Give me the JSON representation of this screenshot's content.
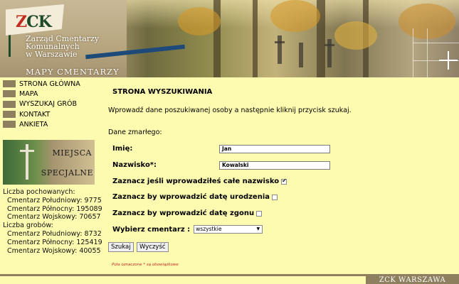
{
  "header": {
    "logo_text_a": "Z",
    "logo_text_b": "CK",
    "org_line1": "Zarząd Cmentarzy",
    "org_line2": "Komunalnych",
    "org_line3": "w Warszawie",
    "subtitle": "MAPY CMENTARZY"
  },
  "nav": {
    "items": [
      "STRONA GŁÓWNA",
      "MAPA",
      "WYSZUKAJ GRÓB",
      "KONTAKT",
      "ANKIETA"
    ]
  },
  "special": {
    "line1": "MIEJSCA",
    "line2": "SPECJALNE"
  },
  "stats": {
    "buried_label": "Liczba pochowanych:",
    "buried": [
      "Cmentarz Południowy: 9775",
      "Cmentarz Północny: 195089",
      "Cmentarz Wojskowy: 70657"
    ],
    "graves_label": "Liczba grobów:",
    "graves": [
      "Cmentarz Południowy: 8732",
      "Cmentarz Północny: 125419",
      "Cmentarz Wojskowy: 40055"
    ]
  },
  "main": {
    "title": "STRONA WYSZUKIWANIA",
    "intro": "Wprowadź dane poszukiwanej osoby a następnie kliknij przycisk szukaj.",
    "section": "Dane zmarłego:",
    "first_name_label": "Imię:",
    "first_name_value": "Jan",
    "last_name_label": "Nazwisko*:",
    "last_name_value": "Kowalski",
    "full_name_check": "Zaznacz jeśli wprowadziłeś całe nazwisko",
    "birth_check": "Zaznacz by wprowadzić datę urodzenia",
    "death_check": "Zaznacz by wprowadzić datę zgonu",
    "cemetery_label": "Wybierz cmentarz :",
    "cemetery_value": "wszystkie",
    "search_button": "Szukaj",
    "clear_button": "Wyczyść",
    "required_note": "Pola oznaczone * są obowiązkowe"
  },
  "footer": {
    "brand": "ZCK WARSZAWA"
  }
}
